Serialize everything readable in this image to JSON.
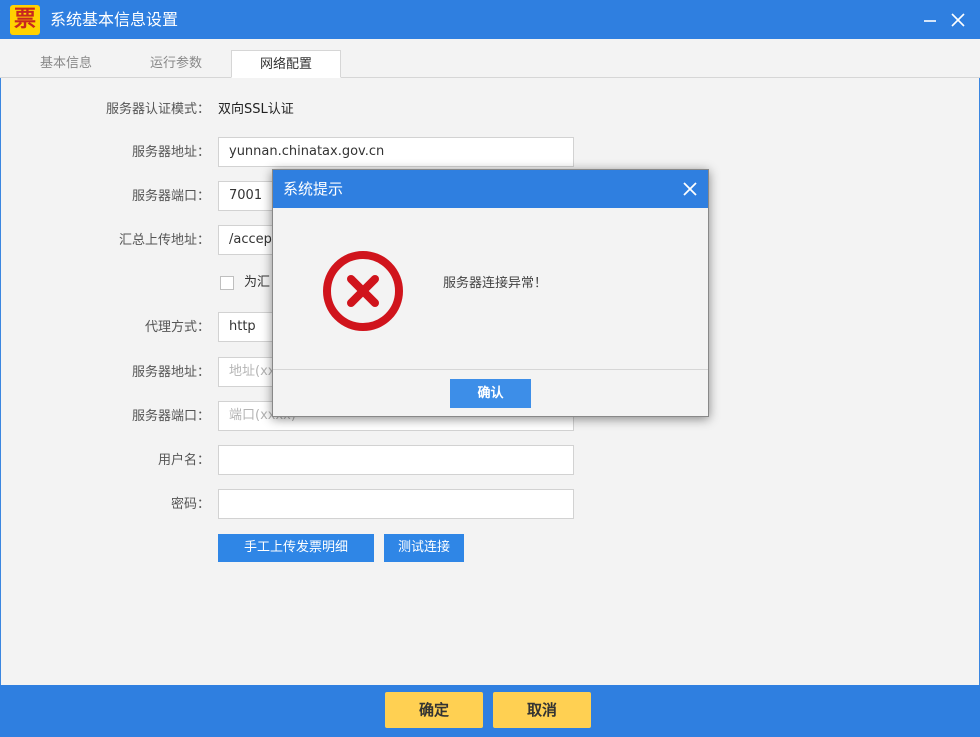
{
  "window": {
    "title": "系统基本信息设置",
    "app_icon_char": "票"
  },
  "tabs": [
    {
      "label": "基本信息",
      "active": false
    },
    {
      "label": "运行参数",
      "active": false
    },
    {
      "label": "网络配置",
      "active": true
    }
  ],
  "form": {
    "auth_mode_label": "服务器认证模式：",
    "auth_mode_value": "双向SSL认证",
    "server_addr_label": "服务器地址：",
    "server_addr_value": "yunnan.chinatax.gov.cn",
    "server_port_label": "服务器端口：",
    "server_port_value": "7001",
    "upload_addr_label": "汇总上传地址：",
    "upload_addr_value": "/accep",
    "checkbox_label": "为汇",
    "proxy_type_label": "代理方式：",
    "proxy_type_value": "http",
    "proxy_addr_label": "服务器地址：",
    "proxy_addr_placeholder": "地址(xx",
    "proxy_port_label": "服务器端口：",
    "proxy_port_placeholder": "端口(xxxx)",
    "username_label": "用户名：",
    "username_value": "",
    "password_label": "密码：",
    "password_value": "",
    "upload_button": "手工上传发票明细",
    "test_button": "测试连接"
  },
  "footer": {
    "ok_button": "确定",
    "cancel_button": "取消"
  },
  "dialog": {
    "title": "系统提示",
    "message": "服务器连接异常！",
    "confirm_button": "确认"
  },
  "colors": {
    "titlebar": "#2f7fe0",
    "error_red": "#d0141c",
    "footer_button": "#ffd052"
  }
}
